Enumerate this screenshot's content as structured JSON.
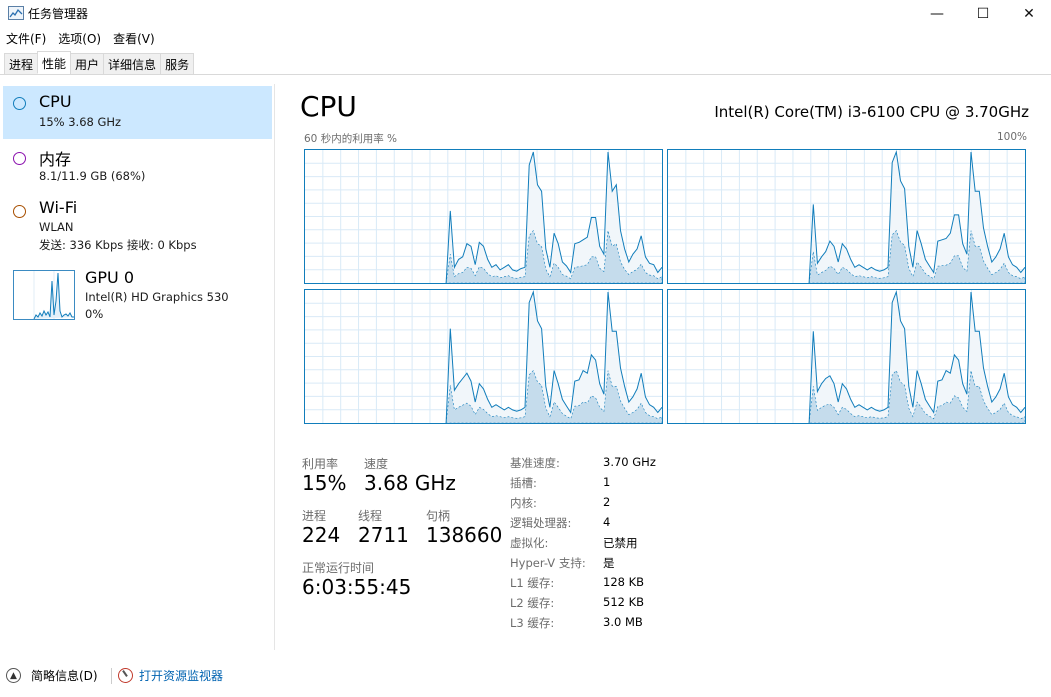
{
  "window": {
    "title": "任务管理器",
    "min_glyph": "—",
    "max_glyph": "☐",
    "close_glyph": "✕"
  },
  "menu": [
    "文件(F)",
    "选项(O)",
    "查看(V)"
  ],
  "tabs": [
    {
      "label": "进程",
      "active": false
    },
    {
      "label": "性能",
      "active": true
    },
    {
      "label": "用户",
      "active": false
    },
    {
      "label": "详细信息",
      "active": false
    },
    {
      "label": "服务",
      "active": false
    }
  ],
  "sidebar": {
    "cpu": {
      "title": "CPU",
      "sub": "15%  3.68 GHz",
      "color": "#117dbb"
    },
    "memory": {
      "title": "内存",
      "sub": "8.1/11.9 GB (68%)",
      "color": "#8b12ae"
    },
    "wifi": {
      "title": "Wi-Fi",
      "sub1": "WLAN",
      "sub2": "发送: 336 Kbps  接收: 0 Kbps",
      "color": "#a74f01"
    },
    "gpu": {
      "title": "GPU 0",
      "sub1": "Intel(R) HD Graphics 530",
      "sub2": "0%"
    }
  },
  "main": {
    "title": "CPU",
    "model": "Intel(R) Core(TM) i3-6100 CPU @ 3.70GHz",
    "graph_label_left": "60 秒内的利用率 %",
    "graph_label_right": "100%",
    "accent_color": "#117dbb",
    "fill_color": "#f1f6fa"
  },
  "cores": [
    {
      "series": [
        0,
        0,
        0,
        0,
        0,
        0,
        0,
        0,
        0,
        0,
        0,
        0,
        0,
        0,
        0,
        0,
        0,
        0,
        0,
        0,
        0,
        0,
        0,
        0,
        0,
        0,
        0,
        0,
        0,
        0,
        0,
        0,
        0,
        0,
        0,
        55,
        12,
        18,
        20,
        30,
        28,
        14,
        31,
        28,
        18,
        12,
        14,
        10,
        12,
        14,
        10,
        9,
        11,
        12,
        90,
        100,
        75,
        70,
        26,
        12,
        38,
        30,
        16,
        13,
        8,
        30,
        31,
        33,
        35,
        50,
        50,
        28,
        22,
        100,
        70,
        75,
        40,
        26,
        16,
        22,
        26,
        36,
        20,
        15,
        14,
        8,
        12
      ]
    },
    {
      "series": [
        0,
        0,
        0,
        0,
        0,
        0,
        0,
        0,
        0,
        0,
        0,
        0,
        0,
        0,
        0,
        0,
        0,
        0,
        0,
        0,
        0,
        0,
        0,
        0,
        0,
        0,
        0,
        0,
        0,
        0,
        0,
        0,
        0,
        0,
        0,
        60,
        15,
        20,
        24,
        32,
        28,
        16,
        30,
        26,
        18,
        12,
        14,
        12,
        10,
        12,
        10,
        9,
        10,
        12,
        92,
        100,
        78,
        72,
        28,
        12,
        40,
        30,
        18,
        13,
        8,
        32,
        33,
        34,
        38,
        52,
        52,
        30,
        22,
        100,
        70,
        70,
        42,
        28,
        16,
        20,
        26,
        38,
        20,
        14,
        12,
        8,
        12
      ]
    },
    {
      "series": [
        0,
        0,
        0,
        0,
        0,
        0,
        0,
        0,
        0,
        0,
        0,
        0,
        0,
        0,
        0,
        0,
        0,
        0,
        0,
        0,
        0,
        0,
        0,
        0,
        0,
        0,
        0,
        0,
        0,
        0,
        0,
        0,
        0,
        0,
        0,
        72,
        25,
        30,
        34,
        38,
        32,
        16,
        30,
        26,
        18,
        12,
        14,
        12,
        10,
        12,
        10,
        9,
        10,
        12,
        92,
        100,
        78,
        72,
        28,
        12,
        40,
        30,
        18,
        13,
        8,
        32,
        33,
        40,
        38,
        52,
        48,
        30,
        22,
        100,
        70,
        70,
        42,
        28,
        16,
        20,
        26,
        38,
        20,
        14,
        12,
        8,
        12
      ]
    },
    {
      "series": [
        0,
        0,
        0,
        0,
        0,
        0,
        0,
        0,
        0,
        0,
        0,
        0,
        0,
        0,
        0,
        0,
        0,
        0,
        0,
        0,
        0,
        0,
        0,
        0,
        0,
        0,
        0,
        0,
        0,
        0,
        0,
        0,
        0,
        0,
        0,
        70,
        24,
        30,
        34,
        36,
        30,
        16,
        30,
        26,
        18,
        12,
        14,
        12,
        10,
        12,
        10,
        9,
        10,
        12,
        92,
        100,
        78,
        72,
        28,
        12,
        40,
        30,
        18,
        13,
        8,
        32,
        33,
        40,
        38,
        52,
        48,
        30,
        22,
        100,
        70,
        70,
        42,
        28,
        16,
        20,
        26,
        38,
        20,
        14,
        12,
        8,
        12
      ]
    }
  ],
  "stats": {
    "util_label": "利用率",
    "util_value": "15%",
    "speed_label": "速度",
    "speed_value": "3.68 GHz",
    "proc_label": "进程",
    "proc_value": "224",
    "thread_label": "线程",
    "thread_value": "2711",
    "handle_label": "句柄",
    "handle_value": "138660",
    "uptime_label": "正常运行时间",
    "uptime_value": "6:03:55:45"
  },
  "specs": [
    {
      "label": "基准速度:",
      "value": "3.70 GHz"
    },
    {
      "label": "插槽:",
      "value": "1"
    },
    {
      "label": "内核:",
      "value": "2"
    },
    {
      "label": "逻辑处理器:",
      "value": "4"
    },
    {
      "label": "虚拟化:",
      "value": "已禁用"
    },
    {
      "label": "Hyper-V 支持:",
      "value": "是"
    },
    {
      "label": "L1 缓存:",
      "value": "128 KB"
    },
    {
      "label": "L2 缓存:",
      "value": "512 KB"
    },
    {
      "label": "L3 缓存:",
      "value": "3.0 MB"
    }
  ],
  "bottom": {
    "fewer_details": "简略信息(D)",
    "resource_monitor": "打开资源监视器"
  }
}
